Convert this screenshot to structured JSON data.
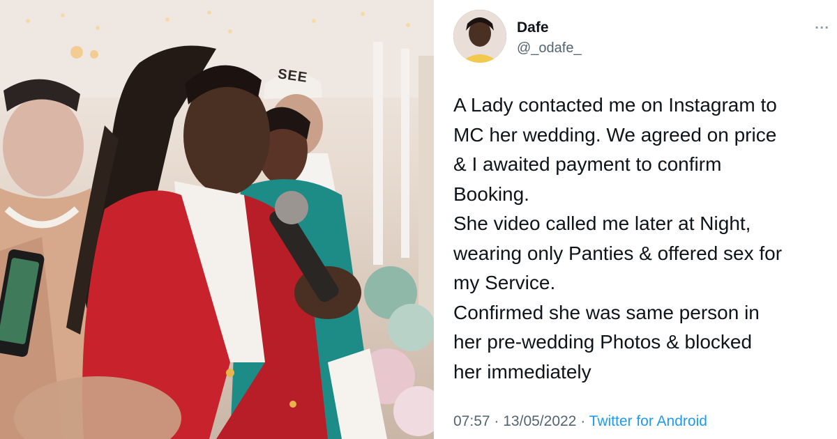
{
  "photo": {
    "cap_text": "SEE"
  },
  "tweet": {
    "author": {
      "name": "Dafe",
      "handle": "@_odafe_"
    },
    "more_icon": "more-options-icon",
    "body_lines": [
      "A Lady contacted me on Instagram to",
      "MC her wedding. We agreed on price",
      "& I awaited payment to confirm",
      "Booking.",
      "She video called me later at Night,",
      "wearing only Panties & offered sex for",
      "my Service.",
      "Confirmed she was same  person in",
      "her pre-wedding Photos & blocked",
      "her immediately"
    ],
    "time": "07:57",
    "separator": "·",
    "date": "13/05/2022",
    "source": "Twitter for Android",
    "colors": {
      "text": "#0f1419",
      "secondary": "#536471",
      "link": "#1d9bf0"
    }
  }
}
